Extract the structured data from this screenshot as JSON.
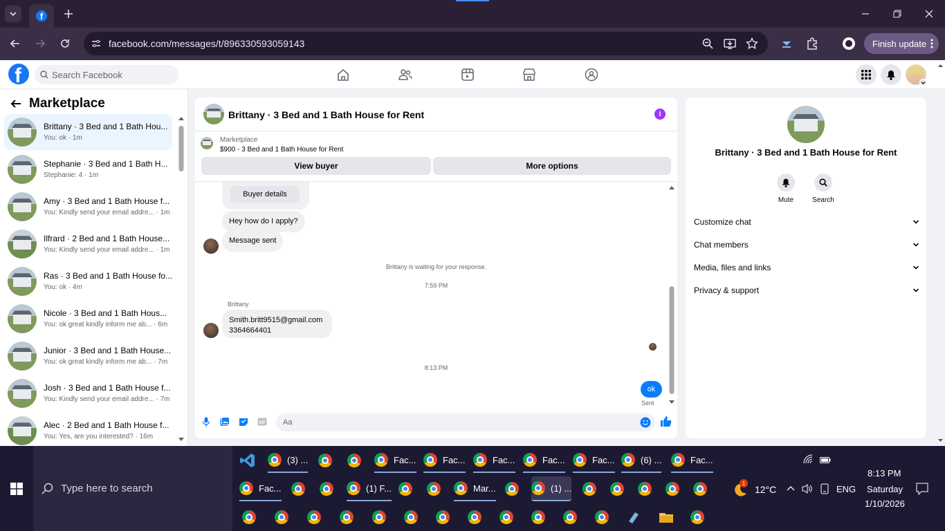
{
  "browser": {
    "tab_icon": "facebook-icon",
    "url": "facebook.com/messages/t/896330593059143",
    "finish_update_label": "Finish update"
  },
  "facebook": {
    "search_placeholder": "Search Facebook"
  },
  "sidebar": {
    "title": "Marketplace",
    "conversations": [
      {
        "name": "Brittany · 3 Bed and 1 Bath Hou...",
        "preview": "You: ok · 1m",
        "active": true
      },
      {
        "name": "Stephanie · 3 Bed and 1 Bath H...",
        "preview": "Stephanie: 4 · 1m"
      },
      {
        "name": "Amy · 3 Bed and 1 Bath House f...",
        "preview": "You: Kindly send your email addre... · 1m"
      },
      {
        "name": "Ilfrard · 2 Bed and 1 Bath House...",
        "preview": "You: Kindly send your email addre... · 1m"
      },
      {
        "name": "Ras · 3 Bed and 1 Bath House fo...",
        "preview": "You: ok · 4m"
      },
      {
        "name": "Nicole · 3 Bed and 1 Bath Hous...",
        "preview": "You: ok great kindly inform me ab... · 6m"
      },
      {
        "name": "Junior · 3 Bed and 1 Bath House...",
        "preview": "You: ok great kindly inform me ab... · 7m"
      },
      {
        "name": "Josh · 3 Bed and 1 Bath House f...",
        "preview": "You: Kindly send your email addre... · 7m"
      },
      {
        "name": "Alec · 2 Bed and 1 Bath House f...",
        "preview": "You: Yes, are you interested? · 16m"
      }
    ]
  },
  "chat": {
    "title": "Brittany · 3 Bed and 1 Bath House for Rent",
    "marketplace_label": "Marketplace",
    "listing": "$900 - 3 Bed and 1 Bath House for Rent",
    "view_buyer": "View buyer",
    "more_options": "More options",
    "messages": {
      "buyer_details": "Buyer details",
      "apply_question": "Hey how do I apply?",
      "message_sent": "Message sent",
      "waiting": "Brittany is waiting for your response.",
      "time1": "7:59 PM",
      "sender_name": "Brittany",
      "email_line1": "Smith.britt9515@gmail.com",
      "email_line2": "3364664401",
      "time2": "8:13 PM",
      "my_reply": "ok",
      "sent_status": "Sent"
    },
    "composer_placeholder": "Aa"
  },
  "info_panel": {
    "name": "Brittany · 3 Bed and 1 Bath House for Rent",
    "mute": "Mute",
    "search": "Search",
    "sections": [
      "Customize chat",
      "Chat members",
      "Media, files and links",
      "Privacy & support"
    ]
  },
  "taskbar": {
    "search_placeholder": "Type here to search",
    "row1": [
      "(3) ...",
      "",
      "",
      "Fac...",
      "Fac...",
      "Fac...",
      "Fac...",
      "Fac...",
      "(6) ...",
      "Fac..."
    ],
    "row2": [
      "Fac...",
      "",
      "",
      "(1) F...",
      "",
      "",
      "Mar...",
      "",
      "(1) ...",
      "",
      "",
      "",
      "",
      ""
    ],
    "weather": "12°C",
    "weather_badge": "1",
    "language": "ENG",
    "time": "8:13 PM",
    "day": "Saturday",
    "date": "1/10/2026"
  }
}
